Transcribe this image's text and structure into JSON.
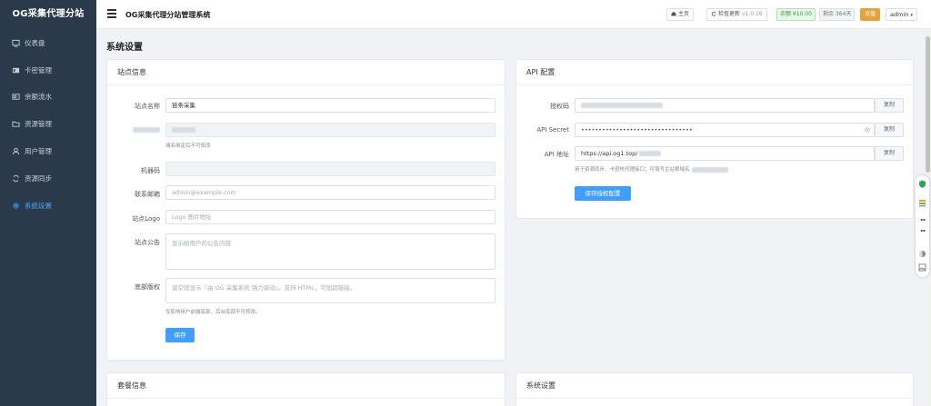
{
  "sidebar": {
    "brand": "OG采集代理分站",
    "items": [
      {
        "label": "仪表盘",
        "icon": "dashboard-icon"
      },
      {
        "label": "卡密管理",
        "icon": "card-key-icon"
      },
      {
        "label": "余额流水",
        "icon": "wallet-icon"
      },
      {
        "label": "资源管理",
        "icon": "folder-icon"
      },
      {
        "label": "用户管理",
        "icon": "user-icon"
      },
      {
        "label": "资源同步",
        "icon": "sync-icon"
      },
      {
        "label": "系统设置",
        "icon": "gear-icon",
        "active": true
      }
    ]
  },
  "topbar": {
    "title": "OG采集代理分站管理系统",
    "home": "主页",
    "check_update": "检查更新",
    "version": "v1.0.16",
    "balance": "余额 ¥10.00",
    "expiry": "剩余 364天",
    "renew": "充值",
    "user": "admin"
  },
  "page": {
    "title": "系统设置"
  },
  "site_info": {
    "title": "站点信息",
    "name_label": "站点名称",
    "name_value": "链条采集",
    "domain_help": "域名绑定后不可修改",
    "machine_label": "机器码",
    "email_label": "联系邮箱",
    "email_placeholder": "admin@example.com",
    "logo_label": "站点Logo",
    "logo_placeholder": "Logo 图片地址",
    "notice_label": "站点公告",
    "notice_placeholder": "显示给用户的公告内容",
    "footer_label": "底部版权",
    "footer_placeholder": "留空则显示『由 OG 采集系统 强力驱动』。支持 HTML，可加超链接。",
    "footer_help": "仅影响用户前端底部，后台底部不可修改。",
    "save": "保存"
  },
  "api_config": {
    "title": "API 配置",
    "auth_label": "授权码",
    "secret_label": "API Secret",
    "secret_value": "••••••••••••••••••••••••••••••••",
    "url_label": "API 地址",
    "url_value": "https://api.og1.top/",
    "url_help": "用于资源同步、卡密核代理接口；可填写主站根域名",
    "copy": "复制",
    "save": "保存授权配置"
  },
  "package_info": {
    "title": "套餐信息"
  },
  "system_settings": {
    "title": "系统设置"
  },
  "colors": {
    "sidebar": "#2b3a4a",
    "accent": "#409eff",
    "orange": "#e6a23c"
  }
}
